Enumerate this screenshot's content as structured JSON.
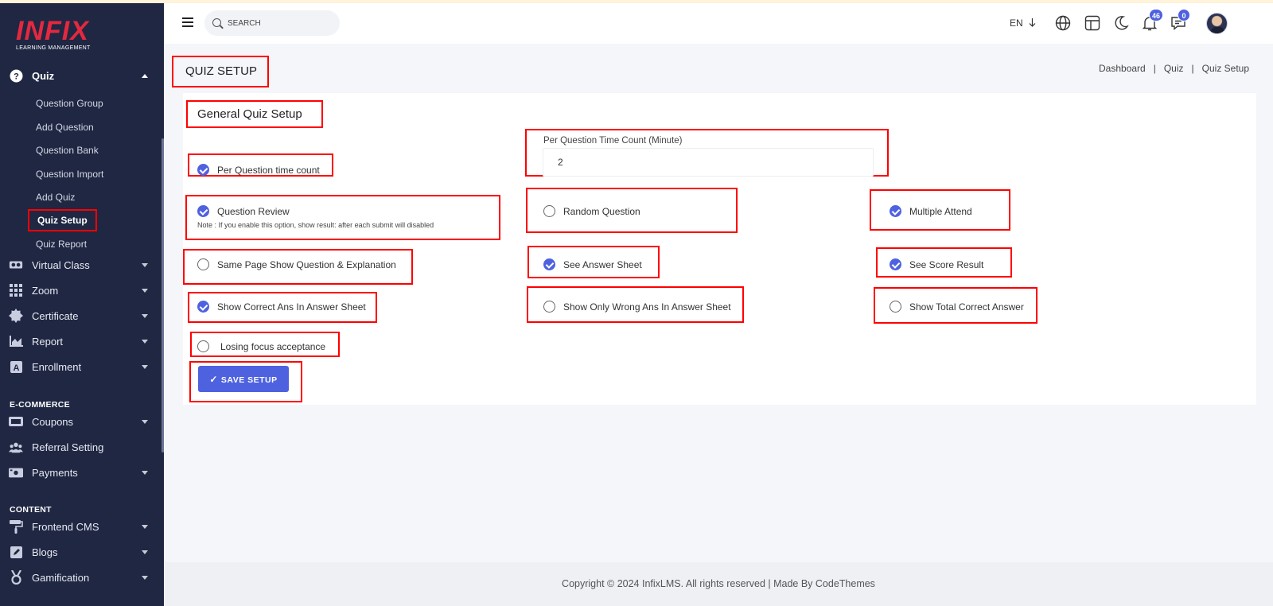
{
  "brand": {
    "logo_text": "INFIX",
    "logo_subtitle": "LEARNING MANAGEMENT"
  },
  "sidebar": {
    "quiz": {
      "label": "Quiz",
      "icon": "question-circle-icon"
    },
    "quiz_subitems": [
      "Question Group",
      "Add Question",
      "Question Bank",
      "Question Import",
      "Add Quiz",
      "Quiz Setup",
      "Quiz Report"
    ],
    "active_subitem": "Quiz Setup",
    "items": [
      {
        "label": "Virtual Class",
        "icon": "virtual-class-icon"
      },
      {
        "label": "Zoom",
        "icon": "zoom-grid-icon"
      },
      {
        "label": "Certificate",
        "icon": "certificate-icon"
      },
      {
        "label": "Report",
        "icon": "report-chart-icon"
      },
      {
        "label": "Enrollment",
        "icon": "enrollment-icon"
      }
    ],
    "ecommerce_title": "E-COMMERCE",
    "ecommerce_items": [
      {
        "label": "Coupons",
        "icon": "coupon-icon"
      },
      {
        "label": "Referral Setting",
        "icon": "referral-icon"
      },
      {
        "label": "Payments",
        "icon": "payment-icon"
      }
    ],
    "content_title": "CONTENT",
    "content_items": [
      {
        "label": "Frontend CMS",
        "icon": "paint-roller-icon"
      },
      {
        "label": "Blogs",
        "icon": "blog-icon"
      },
      {
        "label": "Gamification",
        "icon": "medal-icon"
      }
    ]
  },
  "header": {
    "search_placeholder": "SEARCH",
    "language": "EN",
    "notification_count": "46",
    "message_count": "0"
  },
  "page": {
    "title": "QUIZ SETUP",
    "breadcrumb": [
      "Dashboard",
      "Quiz",
      "Quiz Setup"
    ]
  },
  "card": {
    "title": "General Quiz Setup",
    "time_field": {
      "label": "Per Question Time Count (Minute)",
      "value": "2"
    },
    "options": {
      "per_question_time_count": {
        "label": "Per Question time count",
        "checked": true
      },
      "question_review": {
        "label": "Question Review",
        "checked": true,
        "note": "Note : If you enable this option, show result: after each submit will disabled"
      },
      "random_question": {
        "label": "Random Question",
        "checked": false
      },
      "multiple_attend": {
        "label": "Multiple Attend",
        "checked": true
      },
      "same_page_show": {
        "label": "Same Page Show Question & Explanation",
        "checked": false
      },
      "see_answer_sheet": {
        "label": "See Answer Sheet",
        "checked": true
      },
      "see_score_result": {
        "label": "See Score Result",
        "checked": true
      },
      "show_correct_ans": {
        "label": "Show Correct Ans In Answer Sheet",
        "checked": true
      },
      "show_only_wrong": {
        "label": "Show Only Wrong Ans In Answer Sheet",
        "checked": false
      },
      "show_total_correct": {
        "label": "Show Total Correct Answer",
        "checked": false
      },
      "losing_focus": {
        "label": "Losing focus acceptance",
        "checked": false
      }
    },
    "save_label": "SAVE SETUP"
  },
  "footer": {
    "text": "Copyright © 2024 InfixLMS. All rights reserved | Made By CodeThemes"
  },
  "colors": {
    "sidebar_bg": "#1f2743",
    "accent": "#4e62e0",
    "brand_red": "#e4283f",
    "highlight_box": "#ff0000"
  }
}
